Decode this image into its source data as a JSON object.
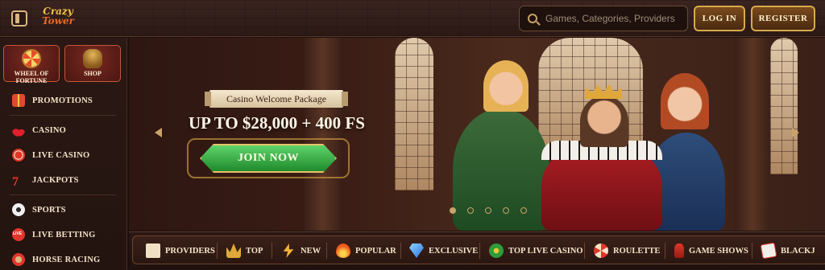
{
  "header": {
    "logo_line1": "Crazy",
    "logo_line2": "Tower",
    "search_placeholder": "Games, Categories, Providers",
    "login_label": "LOG IN",
    "register_label": "REGISTER"
  },
  "sidebar": {
    "tiles": [
      {
        "label": "WHEEL OF FORTUNE",
        "icon": "wheel-icon"
      },
      {
        "label": "SHOP",
        "icon": "basket-icon"
      }
    ],
    "items": [
      {
        "label": "PROMOTIONS",
        "icon": "gift-icon"
      },
      {
        "label": "CASINO",
        "icon": "cherry-icon"
      },
      {
        "label": "LIVE CASINO",
        "icon": "casino-chip-icon"
      },
      {
        "label": "JACKPOTS",
        "icon": "seven-icon"
      },
      {
        "label": "SPORTS",
        "icon": "soccer-ball-icon"
      },
      {
        "label": "LIVE BETTING",
        "icon": "live-icon"
      },
      {
        "label": "HORSE RACING",
        "icon": "horse-icon"
      }
    ]
  },
  "banner": {
    "package_label": "Casino Welcome Package",
    "offer_text": "UP TO $28,000 + 400 FS",
    "cta_label": "JOIN NOW",
    "slides_total": 5,
    "active_slide": 1
  },
  "categories": [
    {
      "label": "PROVIDERS",
      "icon": "scroll-icon"
    },
    {
      "label": "TOP",
      "icon": "crown-icon"
    },
    {
      "label": "NEW",
      "icon": "lightning-icon"
    },
    {
      "label": "POPULAR",
      "icon": "flame-icon"
    },
    {
      "label": "EXCLUSIVE",
      "icon": "diamond-icon"
    },
    {
      "label": "TOP LIVE CASINO",
      "icon": "live-chip-icon"
    },
    {
      "label": "ROULETTE",
      "icon": "roulette-icon"
    },
    {
      "label": "GAME SHOWS",
      "icon": "microphone-icon"
    },
    {
      "label": "BLACKJ",
      "icon": "cards-icon"
    }
  ],
  "colors": {
    "background": "#1b0f0c",
    "gold_border": "#d9a94c",
    "cta_green": "#2e9b3a",
    "accent_red": "#e2362a"
  }
}
